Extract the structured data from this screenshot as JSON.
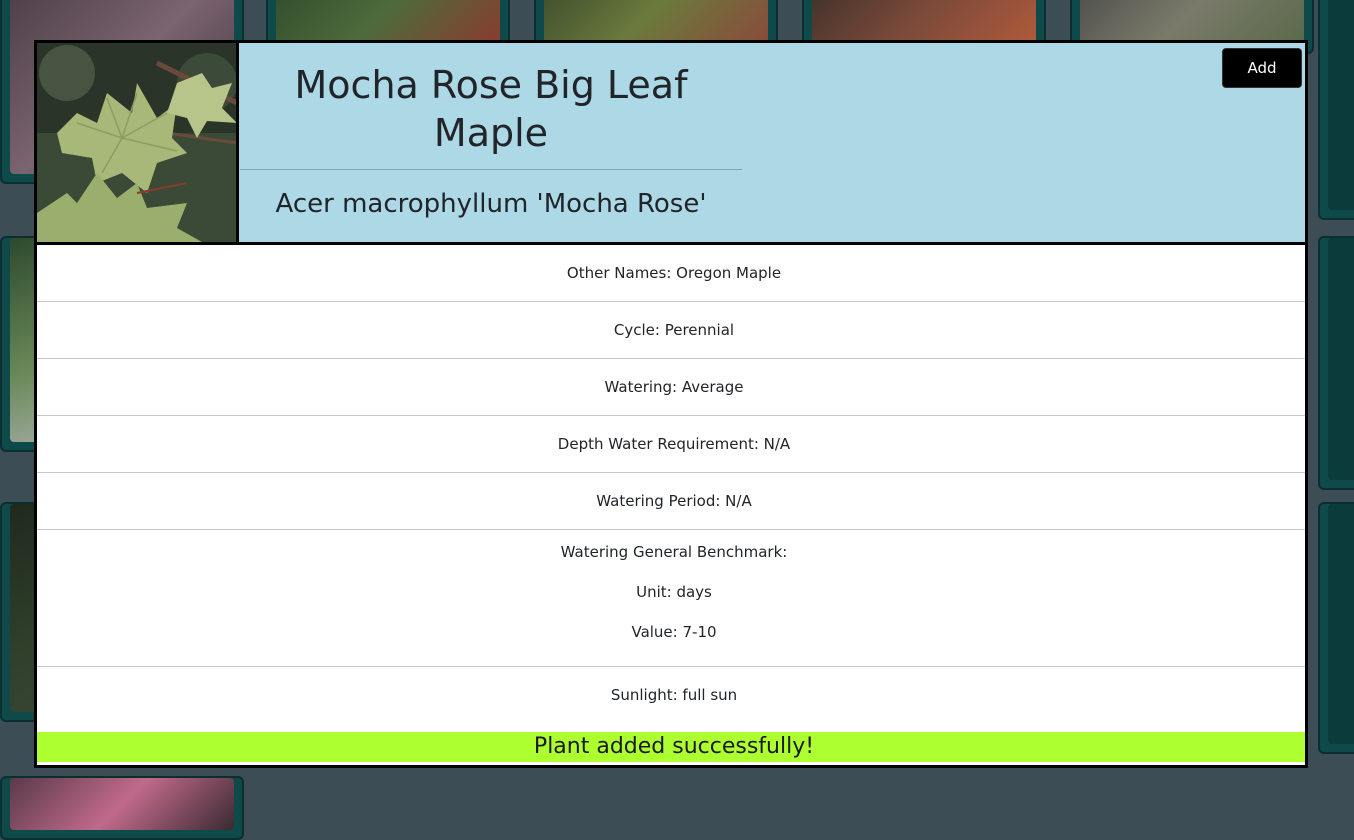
{
  "plant": {
    "common_name": "Mocha Rose Big Leaf Maple",
    "scientific_name": "Acer macrophyllum 'Mocha Rose'",
    "photo_alt": "maple-leaf-photo"
  },
  "header": {
    "add_label": "Add"
  },
  "details": {
    "other_names": "Other Names: Oregon Maple",
    "cycle": "Cycle: Perennial",
    "watering": "Watering: Average",
    "depth_water": "Depth Water Requirement: N/A",
    "watering_period": "Watering Period: N/A",
    "benchmark_title": "Watering General Benchmark:",
    "benchmark_unit": "Unit: days",
    "benchmark_value": "Value: 7-10",
    "sunlight": "Sunlight: full sun"
  },
  "status": {
    "message": "Plant added successfully!",
    "color": "#adff2f"
  },
  "colors": {
    "header_bg": "#add8e6",
    "button_bg": "#000000",
    "page_bg": "#3d4d55",
    "card_bg": "#0e4a4a"
  }
}
